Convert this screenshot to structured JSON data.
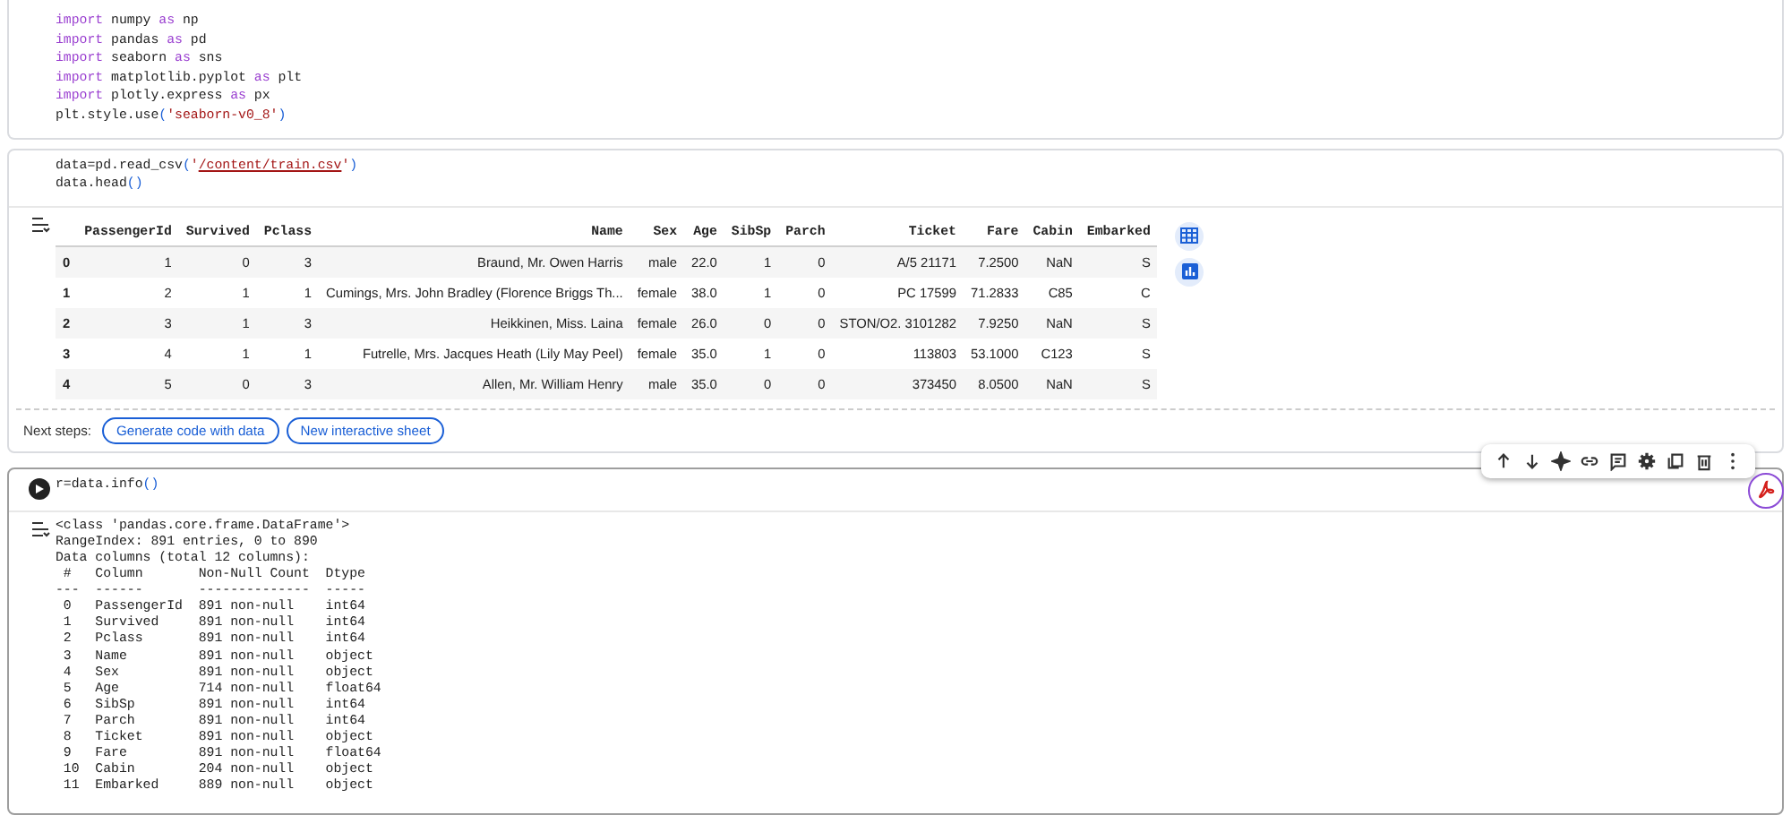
{
  "cells": [
    {
      "kind": "code",
      "focused": false,
      "code": [
        [
          {
            "t": "import",
            "kind": "kw"
          },
          {
            "t": " numpy ",
            "kind": "plain"
          },
          {
            "t": "as",
            "kind": "kw"
          },
          {
            "t": " np",
            "kind": "plain"
          }
        ],
        [
          {
            "t": "import",
            "kind": "kw"
          },
          {
            "t": " pandas ",
            "kind": "plain"
          },
          {
            "t": "as",
            "kind": "kw"
          },
          {
            "t": " pd",
            "kind": "plain"
          }
        ],
        [
          {
            "t": "import",
            "kind": "kw"
          },
          {
            "t": " seaborn ",
            "kind": "plain"
          },
          {
            "t": "as",
            "kind": "kw"
          },
          {
            "t": " sns",
            "kind": "plain"
          }
        ],
        [
          {
            "t": "import",
            "kind": "kw"
          },
          {
            "t": " matplotlib.pyplot ",
            "kind": "plain"
          },
          {
            "t": "as",
            "kind": "kw"
          },
          {
            "t": " plt",
            "kind": "plain"
          }
        ],
        [
          {
            "t": "import",
            "kind": "kw"
          },
          {
            "t": " plotly.express ",
            "kind": "plain"
          },
          {
            "t": "as",
            "kind": "kw"
          },
          {
            "t": " px",
            "kind": "plain"
          }
        ],
        [
          {
            "t": "plt.style.use",
            "kind": "plain"
          },
          {
            "t": "(",
            "kind": "paren"
          },
          {
            "t": "'seaborn-v0_8'",
            "kind": "str"
          },
          {
            "t": ")",
            "kind": "paren"
          }
        ]
      ]
    },
    {
      "kind": "table",
      "focused": false,
      "code": [
        [
          {
            "t": "data=pd.read_csv",
            "kind": "plain"
          },
          {
            "t": "(",
            "kind": "paren"
          },
          {
            "t": "'",
            "kind": "str"
          },
          {
            "t": "/content/train.csv",
            "kind": "link"
          },
          {
            "t": "'",
            "kind": "str"
          },
          {
            "t": ")",
            "kind": "paren"
          }
        ],
        [
          {
            "t": "data.head",
            "kind": "plain"
          },
          {
            "t": "()",
            "kind": "paren"
          }
        ]
      ],
      "table": {
        "columns": [
          "PassengerId",
          "Survived",
          "Pclass",
          "Name",
          "Sex",
          "Age",
          "SibSp",
          "Parch",
          "Ticket",
          "Fare",
          "Cabin",
          "Embarked"
        ],
        "rows": [
          {
            "index": "0",
            "cells": [
              "1",
              "0",
              "3",
              "Braund, Mr. Owen Harris",
              "male",
              "22.0",
              "1",
              "0",
              "A/5 21171",
              "7.2500",
              "NaN",
              "S"
            ]
          },
          {
            "index": "1",
            "cells": [
              "2",
              "1",
              "1",
              "Cumings, Mrs. John Bradley (Florence Briggs Th...",
              "female",
              "38.0",
              "1",
              "0",
              "PC 17599",
              "71.2833",
              "C85",
              "C"
            ]
          },
          {
            "index": "2",
            "cells": [
              "3",
              "1",
              "3",
              "Heikkinen, Miss. Laina",
              "female",
              "26.0",
              "0",
              "0",
              "STON/O2. 3101282",
              "7.9250",
              "NaN",
              "S"
            ]
          },
          {
            "index": "3",
            "cells": [
              "4",
              "1",
              "1",
              "Futrelle, Mrs. Jacques Heath (Lily May Peel)",
              "female",
              "35.0",
              "1",
              "0",
              "113803",
              "53.1000",
              "C123",
              "S"
            ]
          },
          {
            "index": "4",
            "cells": [
              "5",
              "0",
              "3",
              "Allen, Mr. William Henry",
              "male",
              "35.0",
              "0",
              "0",
              "373450",
              "8.0500",
              "NaN",
              "S"
            ]
          }
        ]
      },
      "next_steps": {
        "label": "Next steps:",
        "buttons": [
          "Generate code with data",
          "New interactive sheet"
        ]
      }
    },
    {
      "kind": "text",
      "focused": true,
      "code": [
        [
          {
            "t": "r=data.info",
            "kind": "plain"
          },
          {
            "t": "()",
            "kind": "paren"
          }
        ]
      ],
      "output_lines": [
        "<class 'pandas.core.frame.DataFrame'>",
        "RangeIndex: 891 entries, 0 to 890",
        "Data columns (total 12 columns):",
        " #   Column       Non-Null Count  Dtype  ",
        "---  ------       --------------  -----  ",
        " 0   PassengerId  891 non-null    int64  ",
        " 1   Survived     891 non-null    int64  ",
        " 2   Pclass       891 non-null    int64  ",
        " 3   Name         891 non-null    object ",
        " 4   Sex          891 non-null    object ",
        " 5   Age          714 non-null    float64",
        " 6   SibSp        891 non-null    int64  ",
        " 7   Parch        891 non-null    int64  ",
        " 8   Ticket       891 non-null    object ",
        " 9   Fare         891 non-null    float64",
        " 10  Cabin        204 non-null    object ",
        " 11  Embarked     889 non-null    object "
      ]
    }
  ]
}
